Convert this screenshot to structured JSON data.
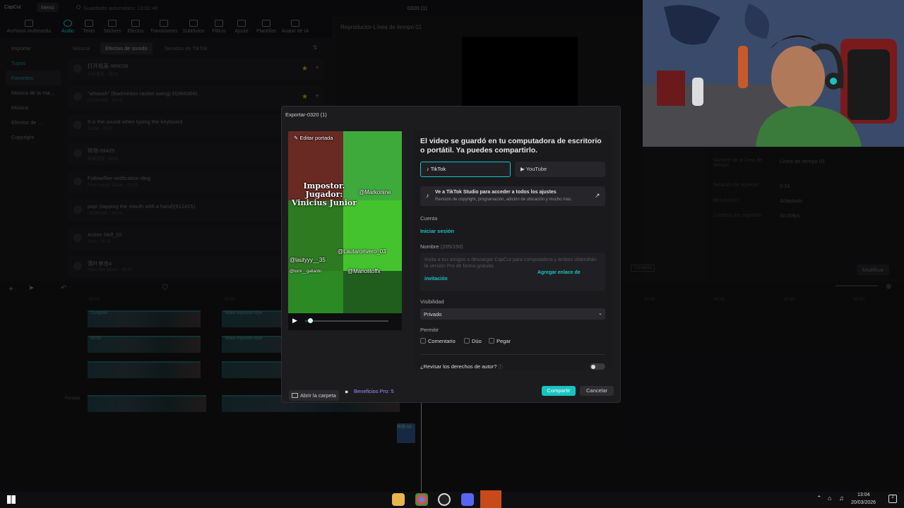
{
  "app": {
    "logo": "CapCut",
    "menu_label": "Menú",
    "autosave": "Guardado automático: 13:02:46",
    "project_title": "0320 (1)"
  },
  "toolbar": {
    "items": [
      {
        "label": "Archivos multimedia",
        "icon": "media-icon"
      },
      {
        "label": "Audio",
        "icon": "audio-icon"
      },
      {
        "label": "Texto",
        "icon": "text-icon"
      },
      {
        "label": "Stickers",
        "icon": "sticker-icon"
      },
      {
        "label": "Efectos",
        "icon": "effects-icon"
      },
      {
        "label": "Transiciones",
        "icon": "transitions-icon"
      },
      {
        "label": "Subtítulos",
        "icon": "subtitles-icon"
      },
      {
        "label": "Filtros",
        "icon": "filters-icon"
      },
      {
        "label": "Ajuste",
        "icon": "adjust-icon"
      },
      {
        "label": "Plantillas",
        "icon": "templates-icon"
      },
      {
        "label": "Avatar de IA",
        "icon": "ai-avatar-icon"
      }
    ]
  },
  "leftnav": {
    "items": [
      "Importar",
      "Tuyos",
      "Favoritos",
      "Música de la ma...",
      "Música",
      "Efectos de ...",
      "Copyright"
    ]
  },
  "audio_tabs": [
    "Música",
    "Efectos de sonido",
    "Sonidos de TikTok"
  ],
  "sounds": [
    {
      "title": "打开瓶盖-989036",
      "sub": "乐乐音效 · 00:01"
    },
    {
      "title": "\"whoosh\" (Badminton racket swing) D(966368)",
      "sub": "LEGRAND · 00:01"
    },
    {
      "title": "It is the sound when typing the keyboard",
      "sub": "Guitar · 00:11"
    },
    {
      "title": "转场-59425",
      "sub": "转场音效 · 00:01"
    },
    {
      "title": "Follow/like notification ding",
      "sub": "Final Sound Studio · 00:01"
    },
    {
      "title": "pop! (tapping the mouth with a hand)(912415)",
      "sub": "LEGRAND · 00:01"
    },
    {
      "title": "Active Skill_02",
      "sub": "Yoko · 00:01"
    },
    {
      "title": "落叶单击4",
      "sub": "Hello Box Music · 00:02"
    }
  ],
  "player": {
    "title": "Reproductor-Línea de tiempo 01"
  },
  "details": {
    "rows": [
      {
        "k": "Nombre de la línea de tiempo:",
        "v": "Línea de tiempo 01"
      },
      {
        "k": "Relación de aspecto:",
        "v": "9:16"
      },
      {
        "k": "Resolución:",
        "v": "Adaptado"
      },
      {
        "k": "Cuadros por segundo:",
        "v": "30.00fps"
      }
    ],
    "modify": "Modificar",
    "complete": "Completa"
  },
  "timeline": {
    "ticks": [
      "00:00",
      "00:10",
      "00:20",
      "00:30",
      "00:40",
      "00:50"
    ],
    "clip_label": "Video impostor.mp4",
    "freeze": "Congelar",
    "freeze_time": "00:00",
    "cover": "Portada",
    "sfx": "转场-59"
  },
  "dialog": {
    "title": "Exportar-0320 (1)",
    "edit_cover": "Editar portada",
    "saved_msg": "El video se guardó en tu computadora de escritorio o portátil. Ya puedes compartirlo.",
    "tiktok": "TikTok",
    "youtube": "YouTube",
    "studio_title": "Ve a TikTok Studio para acceder a todos los ajustes",
    "studio_sub": "Revisión de copyright, programación, adición de ubicación y mucho más.",
    "account_label": "Cuenta",
    "login": "Iniciar sesión",
    "name_label": "Nombre",
    "name_count": "(205/150)",
    "name_value": "Invita a tus amigos a descargar CapCut para computadora y ambos obtendrán la versión Pro de forma gratuita.",
    "invite_link": "Agregar enlace de invitación",
    "visibility_label": "Visibilidad",
    "visibility_value": "Privado",
    "allow_label": "Permitir",
    "allow_options": [
      "Comentario",
      "Dúo",
      "Pegar"
    ],
    "copyright_check": "¿Revisar los derechos de autor?",
    "open_folder": "Abrir la carpeta",
    "pro_benefits": "Beneficios Pro: 5",
    "share": "Compartir",
    "cancel": "Cancelar"
  },
  "video_overlay": {
    "headline": "Impostor. Jugador: Vinicius Junior",
    "tags": [
      "@Markonine",
      "@Lautarorivero_03",
      "@lautyyy__35",
      "@tomi__gallardo",
      "@Manolitoffx"
    ]
  },
  "taskbar": {
    "time": "13:04",
    "date": "20/03/2026",
    "notif_count": "2"
  },
  "colors": {
    "accent": "#19c3c3",
    "pro": "#a98cf5",
    "bg": "#161618"
  }
}
